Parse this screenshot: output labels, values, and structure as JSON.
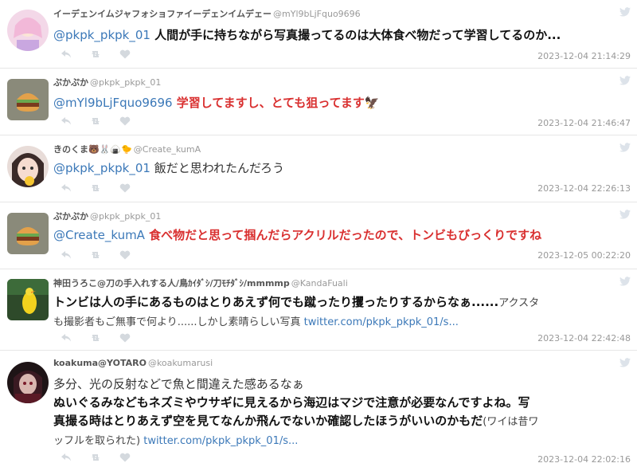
{
  "tweets": [
    {
      "name": "イーデェンイムジャフォショファイーデェンイムデェー",
      "handle": "@mYl9bLjFquo9696",
      "mention": "@pkpk_pkpk_01",
      "text": " 人間が手に持ちながら写真撮ってるのは大体食べ物だって学習してるのか...",
      "time": "2023-12-04 21:14:29"
    },
    {
      "name": "ぷかぷか",
      "handle": "@pkpk_pkpk_01",
      "mention": "@mYl9bLjFquo9696",
      "text": " 学習してますし、とても狙ってます",
      "emoji": "🦅",
      "time": "2023-12-04 21:46:47"
    },
    {
      "name": "きのくま🐻🐰🍙🐤",
      "handle": "@Create_kumA",
      "mention": "@pkpk_pkpk_01",
      "text": " 飯だと思われたんだろう",
      "time": "2023-12-04 22:26:13"
    },
    {
      "name": "ぷかぷか",
      "handle": "@pkpk_pkpk_01",
      "mention": "@Create_kumA",
      "text": " 食べ物だと思って掴んだらアクリルだったので、トンビもびっくりですね",
      "time": "2023-12-05 00:22:20"
    },
    {
      "name": "神田うろこ@刀の手入れする人/鳥ｶｲﾀﾞｼ/刀ﾓﾁﾀﾞｼ/mmmmp",
      "handle": "@KandaFuali",
      "line1_bold": "トンビは人の手にあるものはとりあえず何でも蹴ったり攫ったりするからなぁ......",
      "line1_small": "アクスタ",
      "line2_small": "も撮影者もご無事で何より......しかし素晴らしい写真 ",
      "link": "twitter.com/pkpk_pkpk_01/s...",
      "time": "2023-12-04 22:42:48"
    },
    {
      "name": "koakuma@YOTARO",
      "handle": "@koakumarusi",
      "line1": "多分、光の反射などで魚と間違えた感あるなぁ",
      "line2": "ぬいぐるみなどもネズミやウサギに見えるから海辺はマジで注意が必要なんですよね。写",
      "line3_bold": "真撮る時はとりあえず空を見てなんか飛んでないか確認したほうがいいのかもだ",
      "line3_small": "(ワイは昔ワ",
      "line4_small": "ッフルを取られた) ",
      "link": "twitter.com/pkpk_pkpk_01/s...",
      "time": "2023-12-04 22:02:16"
    }
  ],
  "colors": {
    "mention": "#3b78b8",
    "accent_red": "#d93030",
    "meta": "#999999"
  },
  "icons": [
    "reply-icon",
    "retweet-icon",
    "like-icon",
    "twitter-bird-icon"
  ]
}
